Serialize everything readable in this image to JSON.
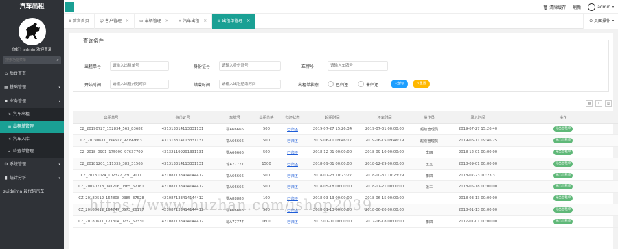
{
  "app": {
    "title": "汽车出租"
  },
  "sidebar": {
    "welcome": "你好！admin,欢迎登录",
    "search_placeholder": "搜索功能菜单",
    "items": [
      {
        "label": "后台首页",
        "icon": "home-icon"
      },
      {
        "label": "基础管理",
        "icon": "grid-icon"
      },
      {
        "label": "业务管理",
        "icon": "briefcase-icon",
        "expanded": true,
        "children": [
          {
            "label": "汽车出租",
            "icon": "double-chevron-right-icon"
          },
          {
            "label": "出租单管理",
            "icon": "list-icon",
            "active": true
          },
          {
            "label": "汽车入库",
            "icon": "double-chevron-left-icon"
          },
          {
            "label": "检查单管理",
            "icon": "check-icon"
          }
        ]
      },
      {
        "label": "系统管理",
        "icon": "gear-icon"
      },
      {
        "label": "统计分析",
        "icon": "chart-icon"
      }
    ],
    "footer_label": "zuidaima 最代码汽车"
  },
  "topbar": {
    "clear_cache": "清除缓存",
    "refresh": "刷新",
    "user": "admin"
  },
  "tabs": [
    {
      "label": "后台首页",
      "icon": "home-icon",
      "closable": false
    },
    {
      "label": "客户管理",
      "icon": "user-icon",
      "closable": true
    },
    {
      "label": "车辆管理",
      "icon": "car-icon",
      "closable": true
    },
    {
      "label": "汽车出租",
      "icon": "double-chevron-right-icon",
      "closable": true
    },
    {
      "label": "出租单管理",
      "icon": "list-icon",
      "closable": true,
      "active": true
    }
  ],
  "page_op": "页面操作",
  "query": {
    "legend": "查询条件",
    "fields": {
      "rent_no": {
        "label": "出租单号",
        "placeholder": "请输入出租单号"
      },
      "id_card": {
        "label": "身份证号",
        "placeholder": "请输入身份证号"
      },
      "car_no": {
        "label": "车牌号",
        "placeholder": "请输入车牌号"
      },
      "start_time": {
        "label": "开始时间",
        "placeholder": "请输入出租开始时间"
      },
      "end_time": {
        "label": "结束时间",
        "placeholder": "请输入出租结束时间"
      },
      "status": {
        "label": "出租单状态",
        "options": [
          "已归还",
          "未归还"
        ]
      }
    },
    "btn_query": "查询",
    "btn_reset": "重置"
  },
  "table": {
    "columns": [
      "出租单号",
      "身份证号",
      "车牌号",
      "出租价格",
      "归还状态",
      "起租时间",
      "还车时间",
      "操作员",
      "录入时间",
      "操作"
    ],
    "action_label": "导出出租单",
    "rows": [
      [
        "CZ_20190727_152834_563_83682",
        "431313314113331131",
        "鄂A66666",
        "500",
        "已归还",
        "2019-07-27 15:26:34",
        "2019-07-31 00:00:00",
        "超级管理员",
        "2019-07-27 15:26:40"
      ],
      [
        "CZ_20190611_094617_92192663",
        "431313314113331131",
        "鄂A66666",
        "500",
        "已归还",
        "2015-06-11 09:46:17",
        "2019-06-15 09:46:19",
        "超级管理员",
        "2019-06-11 09:46:25"
      ],
      [
        "CZ_2018_0901_175000_97637709",
        "431321199291331131",
        "鄂A66666",
        "500",
        "已归还",
        "2018-12-01 00:00:00",
        "2018-09-10 00:00:00",
        "李四",
        "2018-12-01 00:00:00"
      ],
      [
        "CZ_20181201_111335_383_31565",
        "431313314113331131",
        "琼A77777",
        "1500",
        "已归还",
        "2018-09-01 00:00:00",
        "2018-12-29 00:00:00",
        "王五",
        "2018-09-01 00:00:00"
      ],
      [
        "CZ_20181024_102327_730_9111",
        "421087133414144412",
        "鄂A66666",
        "500",
        "已归还",
        "2018-07-23 10:23:27",
        "2018-10-31 10:23:29",
        "李四",
        "2018-07-23 10:23:31"
      ],
      [
        "CZ_20050718_091206_0365_62161",
        "421087133414144412",
        "鄂A66666",
        "500",
        "已归还",
        "2018-05-18 00:00:00",
        "2018-07-21 00:00:00",
        "张三",
        "2018-05-18 00:00:00"
      ],
      [
        "CZ_20180512_164808_0385_37528",
        "421087133414144412",
        "鄂A88888",
        "100",
        "已归还",
        "2018-03-13 00:00:00",
        "2018-06-15 00:00:00",
        "",
        "2018-03-13 00:00:00"
      ],
      [
        "CZ_20180612_164747_0573_26177",
        "421087133414144412",
        "鄂A66666",
        "500",
        "已归还",
        "2018-01-13 00:00:00",
        "2018-06-20 00:00:00",
        "",
        "2018-01-13 00:00:00"
      ],
      [
        "CZ_20180611_171304_0732_57330",
        "421087133414144412",
        "琼A77777",
        "1600",
        "已归还",
        "2017-01-01 00:00:00",
        "2017-06-18 00:00:00",
        "李四",
        "2017-01-01 00:00:00"
      ]
    ]
  },
  "watermark": "https://www.huzhan.com/ishop2039"
}
